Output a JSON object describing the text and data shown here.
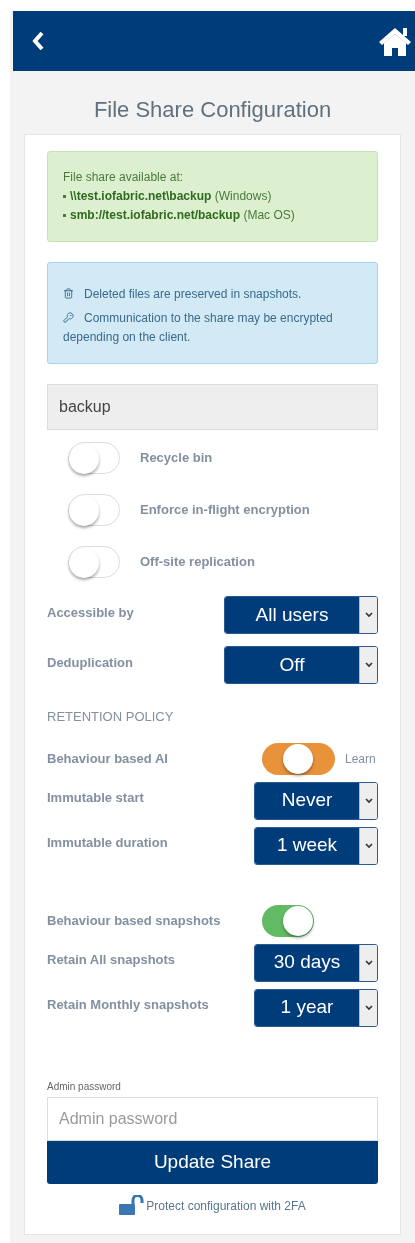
{
  "title": "File Share Configuration",
  "availability": {
    "heading": "File share available at:",
    "links": [
      {
        "path": "\\\\test.iofabric.net\\backup",
        "note": "(Windows)"
      },
      {
        "path": "smb://test.iofabric.net/backup",
        "note": "(Mac OS)"
      }
    ]
  },
  "info": [
    "Deleted files are preserved in snapshots.",
    "Communication to the share may be encrypted depending on the client."
  ],
  "share_name": {
    "value": "backup"
  },
  "options": [
    {
      "label": "Recycle bin",
      "on": false
    },
    {
      "label": "Enforce in-flight encryption",
      "on": false
    },
    {
      "label": "Off-site replication",
      "on": false
    }
  ],
  "settings": [
    {
      "label": "Accessible by",
      "value": "All users"
    },
    {
      "label": "Deduplication",
      "value": "Off"
    }
  ],
  "retention": {
    "heading": "RETENTION POLICY",
    "groups": [
      [
        {
          "kind": "toggle",
          "label": "Behaviour based AI",
          "on": true,
          "color": "#e8923a",
          "note": "Learn"
        },
        {
          "kind": "select",
          "label": "Immutable start",
          "value": "Never"
        },
        {
          "kind": "select",
          "label": "Immutable duration",
          "value": "1 week"
        }
      ],
      [
        {
          "kind": "toggle",
          "label": "Behaviour based snapshots",
          "on": true,
          "color": "#62bb63"
        },
        {
          "kind": "select",
          "label": "Retain All snapshots",
          "value": "30 days"
        },
        {
          "kind": "select",
          "label": "Retain Monthly snapshots",
          "value": "1 year"
        }
      ]
    ]
  },
  "admin_password": {
    "label": "Admin password",
    "placeholder": "Admin password"
  },
  "submit": "Update Share",
  "twofa_link": "Protect configuration with 2FA"
}
